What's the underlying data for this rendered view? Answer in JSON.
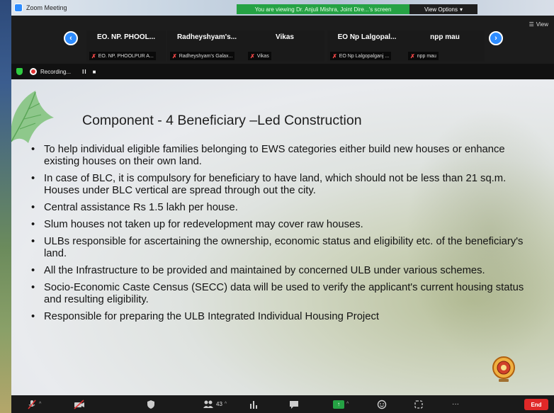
{
  "window": {
    "title": "Zoom Meeting"
  },
  "banner": {
    "viewing_text": "You are viewing Dr. Anjuli Mishra, Joint Dire...'s screen",
    "view_options": "View Options",
    "view_options_caret": "▾"
  },
  "gallery": {
    "view_label": "View",
    "participants": [
      {
        "name": "EO. NP. PHOOL...",
        "label": "EO. NP. PHOOLPUR A..."
      },
      {
        "name": "Radheyshyam's...",
        "label": "Radheyshyam's Galax..."
      },
      {
        "name": "Vikas",
        "label": "Vikas"
      },
      {
        "name": "EO Np Lalgopal...",
        "label": "EO Np Lalgopalganj ..."
      },
      {
        "name": "npp mau",
        "label": "npp mau"
      }
    ],
    "prev_glyph": "‹",
    "next_glyph": "›"
  },
  "recording": {
    "label": "Recording...",
    "pause_glyph": "II",
    "stop_glyph": "■"
  },
  "slide": {
    "title": "Component - 4 Beneficiary –Led Construction",
    "bullets": [
      "To help individual eligible families belonging to EWS categories either build new houses or enhance existing houses on their own land.",
      "In case of BLC, it is compulsory for beneficiary to have land, which should not be less than 21 sq.m. Houses under BLC vertical are spread through out the city.",
      "Central assistance Rs 1.5 lakh per house.",
      "Slum houses not taken up for redevelopment may cover raw houses.",
      "ULBs responsible for ascertaining the ownership, economic status and eligibility etc. of the beneficiary's land.",
      "All the Infrastructure to be provided and maintained by concerned ULB under various schemes.",
      "Socio-Economic Caste Census (SECC) data will be used to verify the applicant's current housing status and resulting eligibility.",
      "Responsible for preparing the ULB Integrated Individual Housing Project"
    ]
  },
  "toolbar": {
    "participants_count": "43",
    "caret": "^",
    "more": "···",
    "end_label": "End"
  },
  "colors": {
    "accent_blue": "#2d8cff",
    "share_green": "#25a244",
    "end_red": "#e02828",
    "mic_off_red": "#ff4a4a"
  },
  "icons": [
    "zoom-app-icon",
    "chevron-left-icon",
    "chevron-right-icon",
    "mic-off-icon",
    "shield-icon",
    "record-icon",
    "mute-icon",
    "video-off-icon",
    "security-icon",
    "participants-icon",
    "polls-icon",
    "chat-icon",
    "share-screen-icon",
    "reactions-icon",
    "apps-icon",
    "more-icon",
    "leaf-decoration",
    "emblem-logo"
  ]
}
